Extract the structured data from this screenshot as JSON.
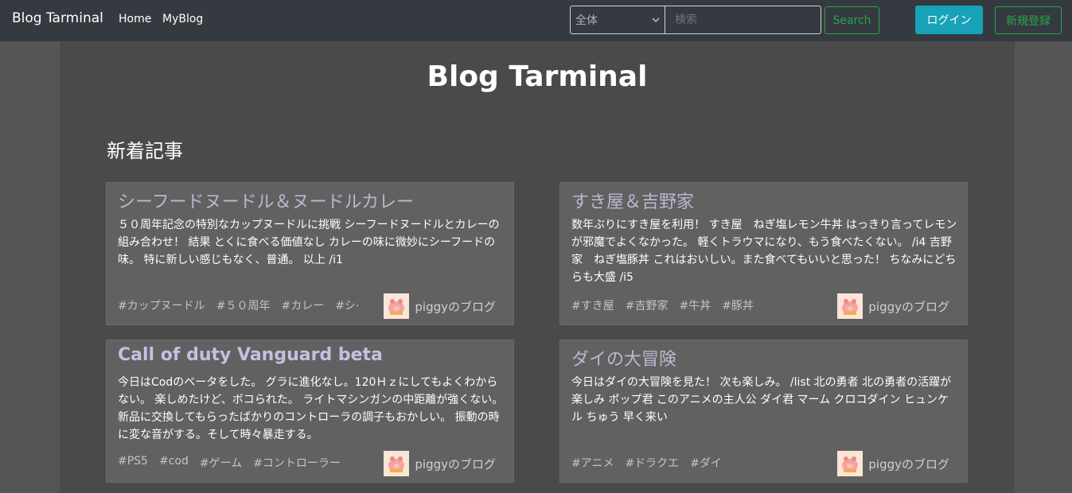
{
  "navbar": {
    "brand": "Blog Tarminal",
    "links": {
      "home": "Home",
      "myblog": "MyBlog"
    },
    "search": {
      "category_selected": "全体",
      "placeholder": "検索",
      "button": "Search"
    },
    "login": "ログイン",
    "signup": "新規登録"
  },
  "main": {
    "title": "Blog Tarminal",
    "section_title": "新着記事"
  },
  "posts": [
    {
      "title": "シーフードヌードル＆ヌードルカレー",
      "body": "５０周年記念の特別なカップヌードルに挑戦 シーフードヌードルとカレーの組み合わせ！ 結果 とくに食べる価値なし カレーの味に微妙にシーフードの味。 特に新しい感じもなく、普通。 以上 /i1",
      "tags": [
        "#カップヌードル",
        "#５０周年",
        "#カレー",
        "#シ·"
      ],
      "author": "piggyのブログ"
    },
    {
      "title": "すき屋＆吉野家",
      "body": "数年ぶりにすき屋を利用！ すき屋　ねぎ塩レモン牛丼 はっきり言ってレモンが邪魔でよくなかった。 軽くトラウマになり、もう食べたくない。 /i4 吉野家　ねぎ塩豚丼 これはおいしい。また食べてもいいと思った！ ちなみにどちらも大盛 /i5",
      "tags": [
        "#すき屋",
        "#吉野家",
        "#牛丼",
        "#豚丼"
      ],
      "author": "piggyのブログ"
    },
    {
      "title": "Call of duty Vanguard beta",
      "body": "今日はCodのベータをした。 グラに進化なし。120Ｈｚにしてもよくわからない。 楽しめたけど、ボコられた。 ライトマシンガンの中距離が強くない。 新品に交換してもらったばかりのコントローラの調子もおかしい。 振動の時に変な音がする。そして時々暴走する。",
      "tags": [
        "#PS5",
        "#cod",
        "#ゲーム",
        "#コントローラー"
      ],
      "author": "piggyのブログ"
    },
    {
      "title": "ダイの大冒険",
      "body": "今日はダイの大冒険を見た！ 次も楽しみ。 /list 北の勇者 北の勇者の活躍が楽しみ ポップ君 このアニメの主人公 ダイ君 マーム クロコダイン ヒュンケル ちゅう 早く来い",
      "tags": [
        "#アニメ",
        "#ドラクエ",
        "#ダイ"
      ],
      "author": "piggyのブログ"
    }
  ]
}
